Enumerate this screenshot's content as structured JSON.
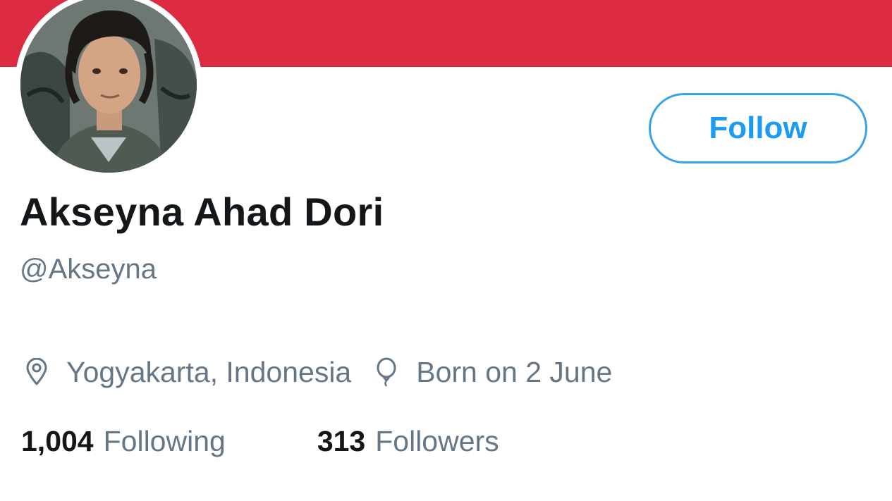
{
  "profile": {
    "banner_color": "#dd2c42",
    "name": "Akseyna Ahad Dori",
    "handle": "@Akseyna",
    "location": "Yogyakarta, Indonesia",
    "birthday": "Born on 2 June",
    "icons": {
      "location": "location-pin-icon",
      "birthday": "balloon-icon"
    }
  },
  "actions": {
    "follow_label": "Follow",
    "accent_color": "#1d9bf0"
  },
  "stats": {
    "following_count": "1,004",
    "following_label": "Following",
    "followers_count": "313",
    "followers_label": "Followers"
  }
}
